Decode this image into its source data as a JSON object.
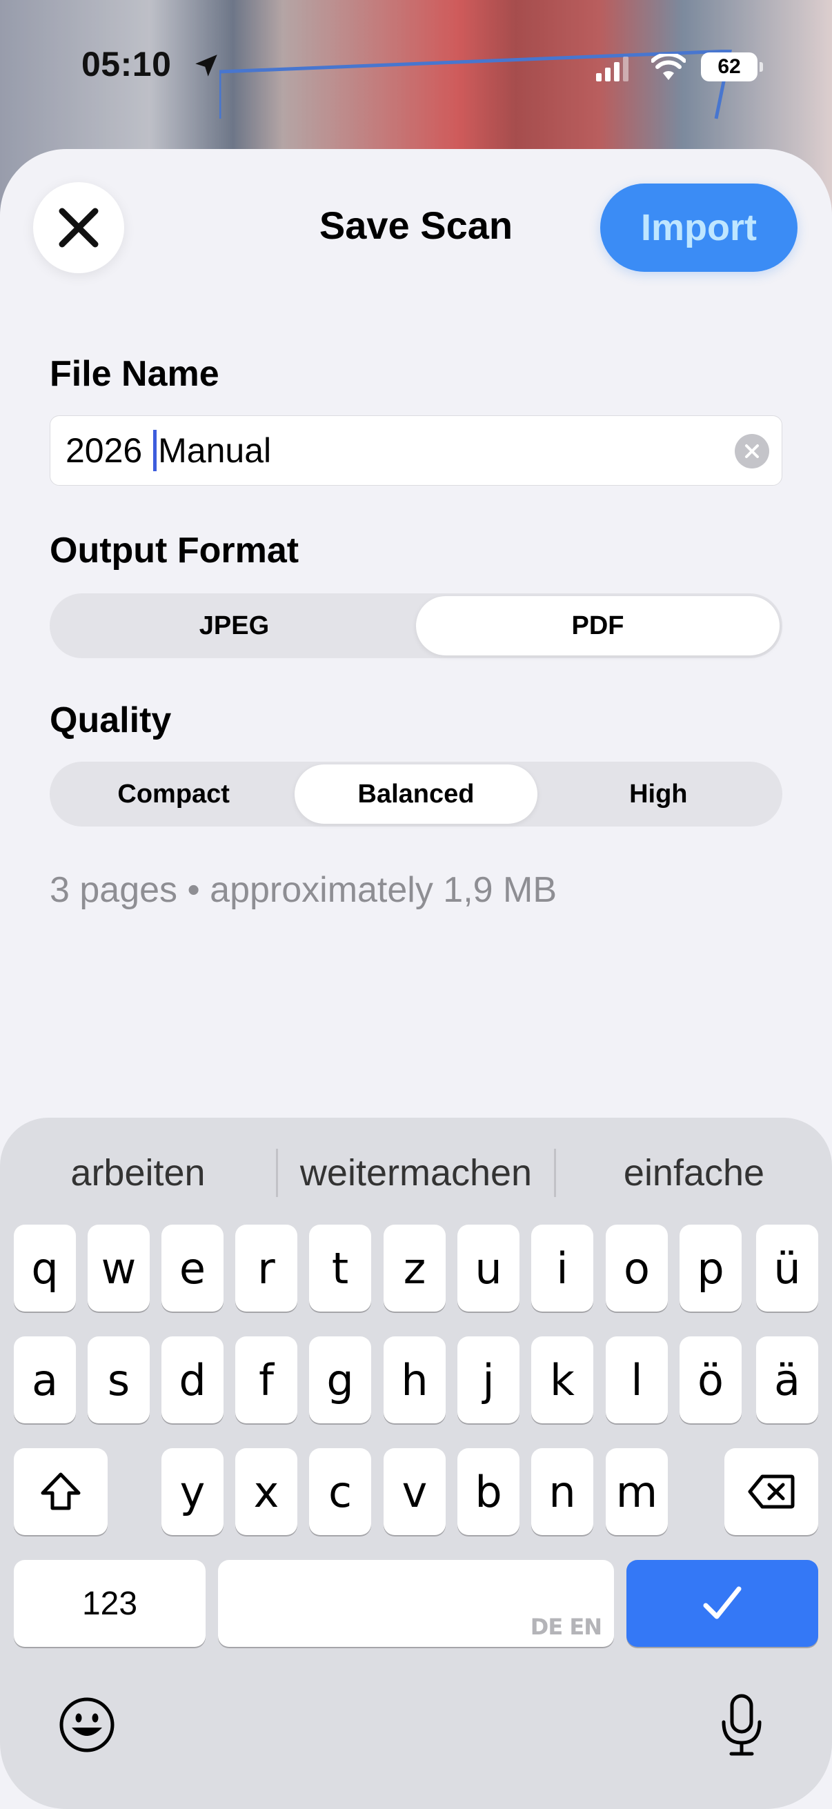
{
  "status": {
    "time": "05:10",
    "battery": "62"
  },
  "sheet": {
    "title": "Save Scan",
    "import_label": "Import"
  },
  "file_name": {
    "label": "File Name",
    "value_before_cursor": "2026 ",
    "value_after_cursor": "Manual"
  },
  "output_format": {
    "label": "Output Format",
    "options": [
      "JPEG",
      "PDF"
    ],
    "selected": "PDF"
  },
  "quality": {
    "label": "Quality",
    "options": [
      "Compact",
      "Balanced",
      "High"
    ],
    "selected": "Balanced"
  },
  "info": "3 pages • approximately 1,9 MB",
  "keyboard": {
    "suggestions": [
      "arbeiten",
      "weitermachen",
      "einfache"
    ],
    "row1": [
      "q",
      "w",
      "e",
      "r",
      "t",
      "z",
      "u",
      "i",
      "o",
      "p",
      "ü"
    ],
    "row2": [
      "a",
      "s",
      "d",
      "f",
      "g",
      "h",
      "j",
      "k",
      "l",
      "ö",
      "ä"
    ],
    "row3": [
      "y",
      "x",
      "c",
      "v",
      "b",
      "n",
      "m"
    ],
    "numbers_label": "123",
    "space_language": "DE EN"
  },
  "colors": {
    "accent": "#3478f6",
    "import_text": "#bfe6ff",
    "sheet_bg": "#f2f2f7",
    "keyboard_bg": "#dcdde2"
  }
}
